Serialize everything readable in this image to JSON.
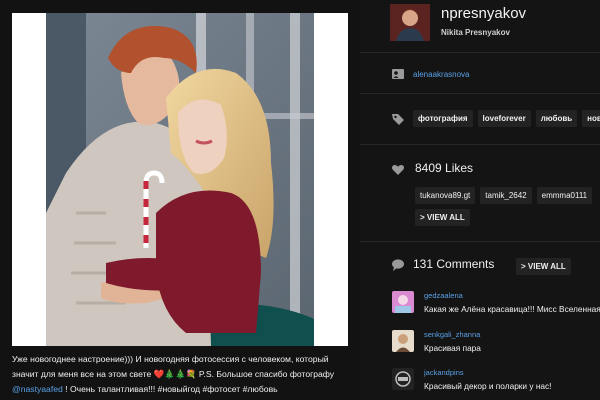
{
  "post": {
    "caption_part1": "Уже новогоднее настроение))) И новогодняя фотосессия с человеком, который значит для меня все на этом свете ❤️🎄🎄💐 P.S. Большое спасибо фотографу ",
    "caption_mention": "@nastyaafed",
    "caption_part2": " ! Очень талантливая!!! #новыйгод #фотосет #любовь"
  },
  "profile": {
    "username": "npresnyakov",
    "full_name": "Nikita Presnyakov",
    "avatar_icon": "user-avatar-icon"
  },
  "location": {
    "name": "alenaakrasnova",
    "icon": "id-card-icon"
  },
  "tags": {
    "icon": "tag-icon",
    "items": [
      "фотография",
      "loveforever",
      "любовь",
      "новый"
    ]
  },
  "likes": {
    "icon": "heart-icon",
    "label": "8409 Likes",
    "users": [
      "tukanova89.gt",
      "tamik_2642",
      "emmma0111"
    ],
    "view_all_label": "> VIEW ALL"
  },
  "comments": {
    "icon": "speech-bubble-icon",
    "label": "131 Comments",
    "view_all_label": "> VIEW ALL",
    "items": [
      {
        "user": "gedzaalena",
        "text": "Какая же Алёна красавица!!! Мисс Вселенная",
        "avatar_color": "#d98ad0"
      },
      {
        "user": "senkgali_zhanna",
        "text": "Красивая пара",
        "avatar_color": "#c9a07a"
      },
      {
        "user": "jackandpins",
        "text": "Красивый декор и поларки у нас!",
        "avatar_color": "#222222"
      }
    ]
  },
  "colors": {
    "background": "#141414",
    "link": "#5aa0e6",
    "chip": "#232323",
    "sweater_red": "#7e1a2c",
    "photo_frame": "#ffffff"
  }
}
